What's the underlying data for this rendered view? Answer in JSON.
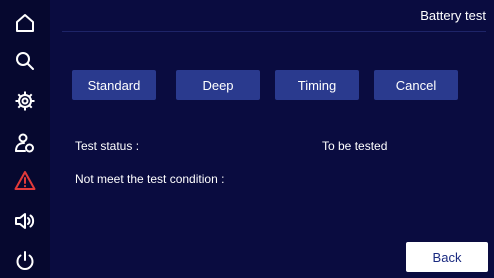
{
  "header": {
    "title": "Battery test"
  },
  "sidebar": {
    "icons": [
      "home-icon",
      "search-icon",
      "gear-icon",
      "user-settings-icon",
      "warning-icon",
      "speaker-icon",
      "power-icon"
    ],
    "warning_color": "#e23a3a"
  },
  "buttons": {
    "standard": "Standard",
    "deep": "Deep",
    "timing": "Timing",
    "cancel": "Cancel",
    "back": "Back"
  },
  "status": {
    "test_status_label": "Test status :",
    "test_status_value": "To be tested",
    "condition_label": "Not meet the test condition :"
  },
  "colors": {
    "background": "#0a0c40",
    "button": "#2a3a8e",
    "back_button": "#ffffff"
  }
}
